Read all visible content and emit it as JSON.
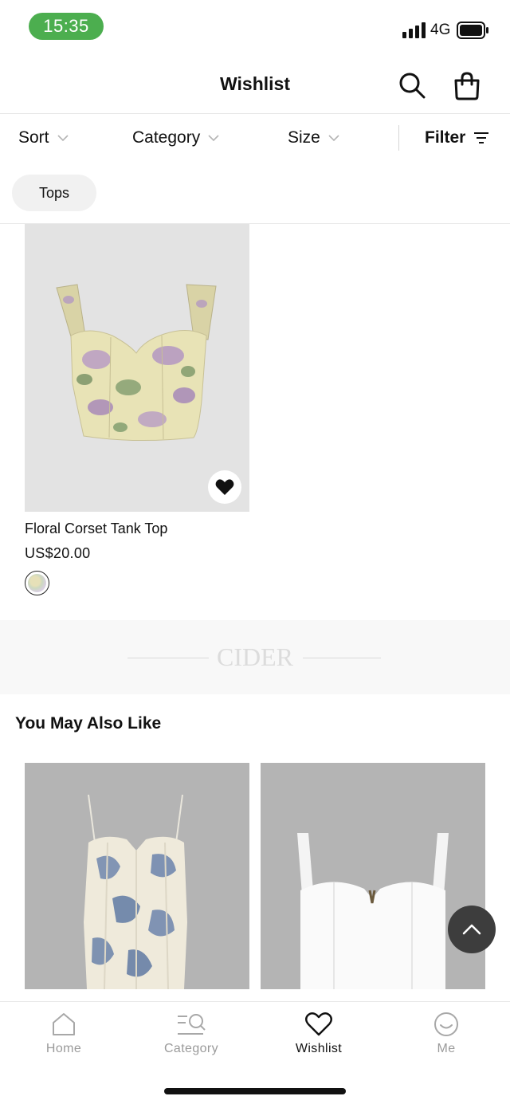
{
  "status_bar": {
    "time": "15:35",
    "network": "4G"
  },
  "header": {
    "title": "Wishlist"
  },
  "filters": {
    "sort_label": "Sort",
    "category_label": "Category",
    "size_label": "Size",
    "filter_label": "Filter"
  },
  "active_chip": "Tops",
  "wishlist_items": [
    {
      "name": "Floral Corset Tank Top",
      "price": "US$20.00",
      "favorited": true
    }
  ],
  "banner": {
    "brand": "CIDER"
  },
  "recommendations": {
    "title": "You May Also Like"
  },
  "bottom_nav": {
    "items": [
      {
        "label": "Home",
        "icon": "home-icon",
        "active": false
      },
      {
        "label": "Category",
        "icon": "category-search-icon",
        "active": false
      },
      {
        "label": "Wishlist",
        "icon": "heart-icon",
        "active": true
      },
      {
        "label": "Me",
        "icon": "smiley-icon",
        "active": false
      }
    ]
  },
  "colors": {
    "time_pill": "#4cae4f",
    "active_nav": "#111111",
    "inactive_nav": "#9a9a9a",
    "back_to_top": "#3d3d3d"
  }
}
